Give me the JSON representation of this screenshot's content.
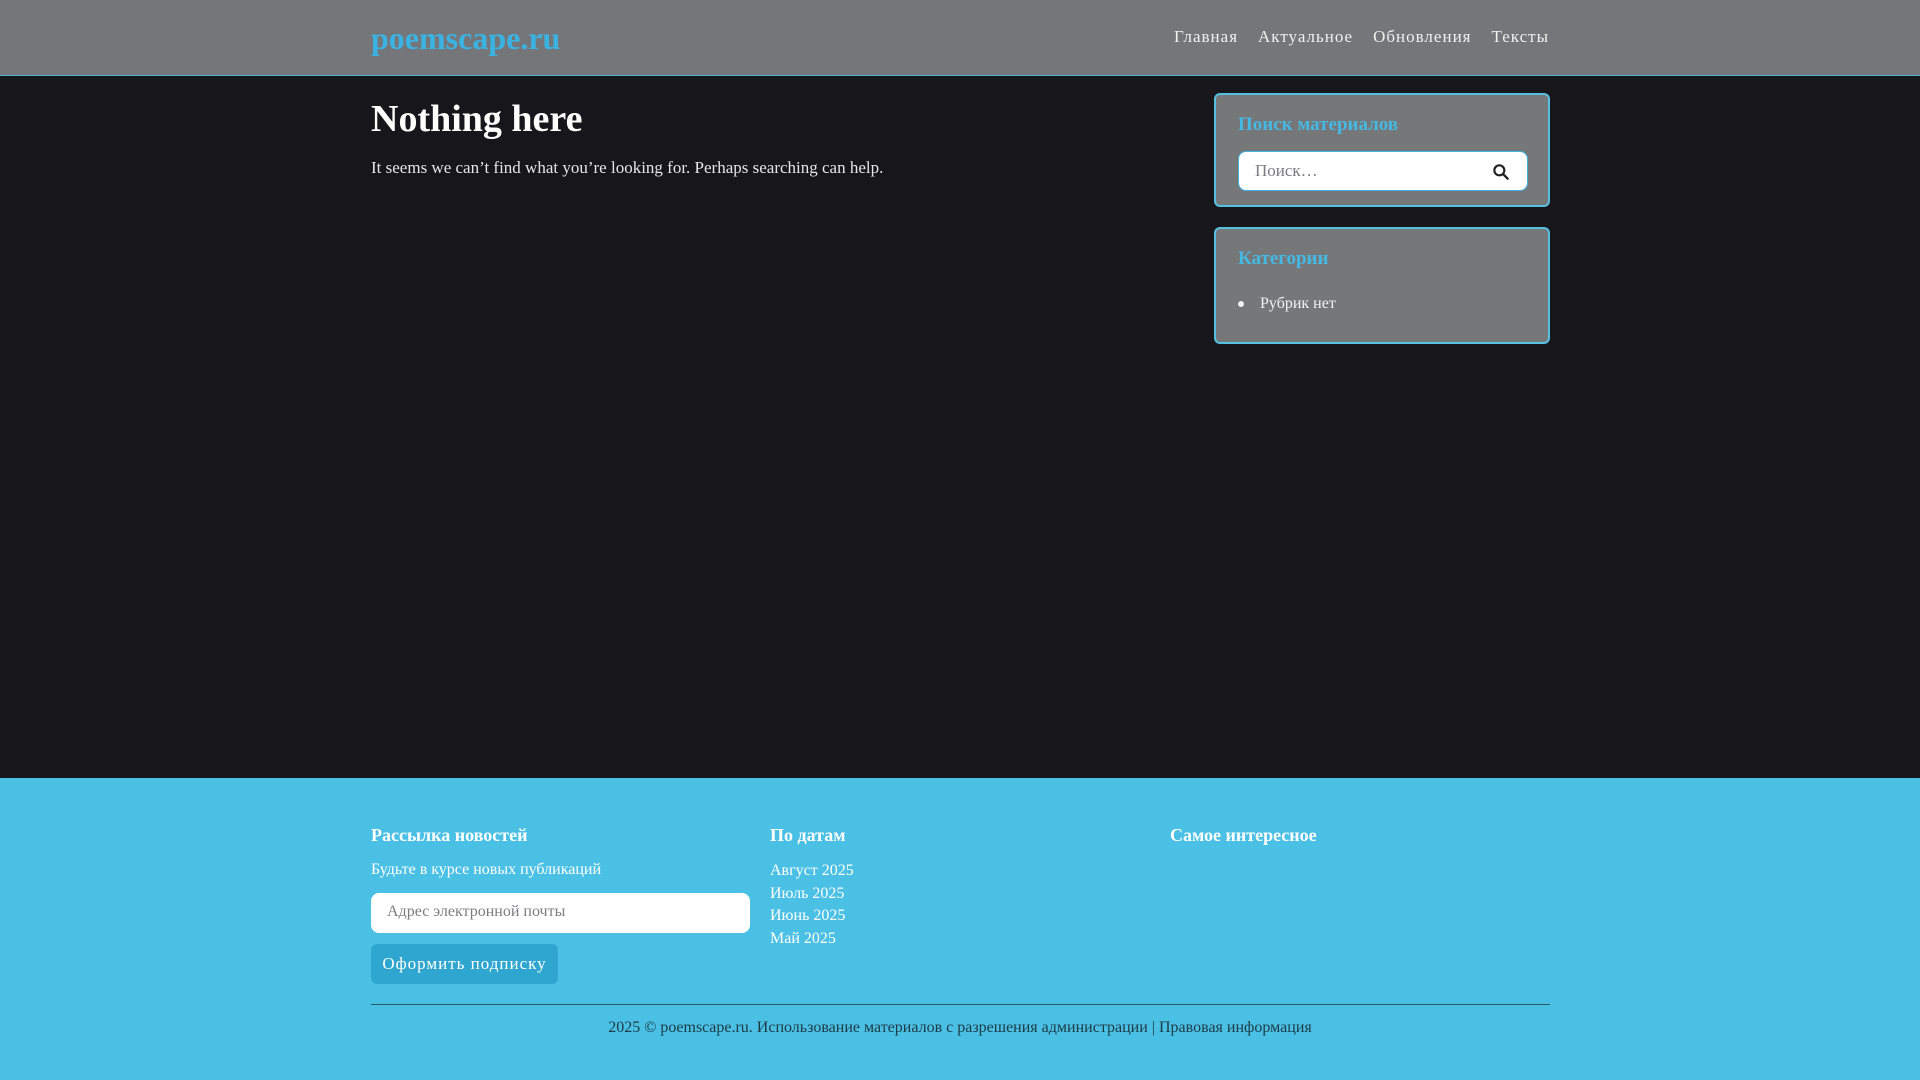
{
  "header": {
    "brand": "poemscape.ru",
    "nav": [
      "Главная",
      "Актуальное",
      "Обновления",
      "Тексты"
    ]
  },
  "main": {
    "title": "Nothing here",
    "text": "It seems we can’t find what you’re looking for. Perhaps searching can help."
  },
  "sidebar": {
    "search": {
      "title": "Поиск материалов",
      "placeholder": "Поиск…",
      "icon": "search-icon"
    },
    "categories": {
      "title": "Категории",
      "items": [
        "Рубрик нет"
      ]
    }
  },
  "footer": {
    "newsletter": {
      "title": "Рассылка новостей",
      "subtitle": "Будьте в курсе новых публикаций",
      "email_placeholder": "Адрес электронной почты",
      "button": "Оформить подписку"
    },
    "archive": {
      "title": "По датам",
      "items": [
        "Август 2025",
        "Июль 2025",
        "Июнь 2025",
        "Май 2025"
      ]
    },
    "popular": {
      "title": "Самое интересное"
    },
    "copyright": "2025 © poemscape.ru. Использование материалов с разрешения администрации | Правовая информация"
  },
  "colors": {
    "accent": "#3ab3e2",
    "footer_bg": "#4ac0e5",
    "page_bg": "#17171b",
    "header_bg": "#757679"
  }
}
